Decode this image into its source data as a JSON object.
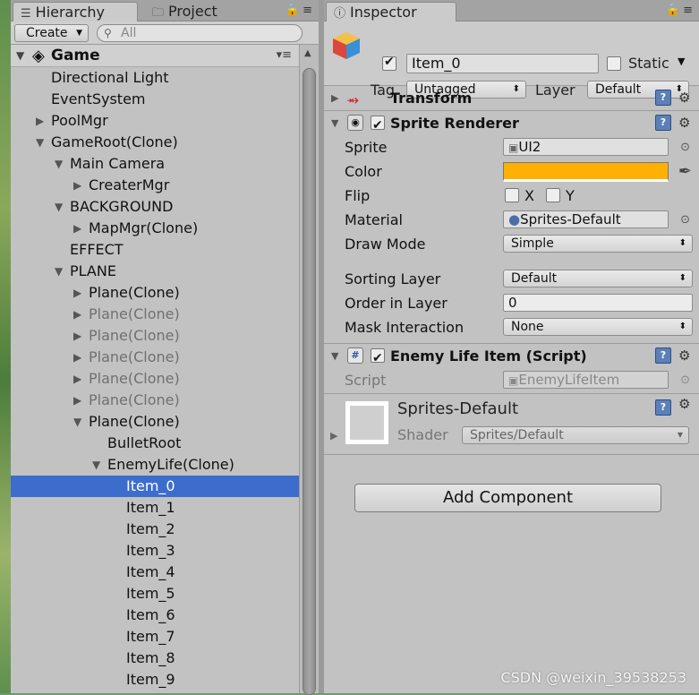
{
  "hierarchy": {
    "tab_label": "Hierarchy",
    "project_tab_label": "Project",
    "create_label": "Create",
    "search_placeholder": "All",
    "scene_name": "Game",
    "items": [
      {
        "label": "Directional Light",
        "depth": 0,
        "arrow": "none",
        "dim": false,
        "selected": false
      },
      {
        "label": "EventSystem",
        "depth": 0,
        "arrow": "none",
        "dim": false,
        "selected": false
      },
      {
        "label": "PoolMgr",
        "depth": 0,
        "arrow": "collapsed",
        "dim": false,
        "selected": false
      },
      {
        "label": "GameRoot(Clone)",
        "depth": 0,
        "arrow": "expanded",
        "dim": false,
        "selected": false
      },
      {
        "label": "Main Camera",
        "depth": 1,
        "arrow": "expanded",
        "dim": false,
        "selected": false
      },
      {
        "label": "CreaterMgr",
        "depth": 2,
        "arrow": "collapsed",
        "dim": false,
        "selected": false
      },
      {
        "label": "BACKGROUND",
        "depth": 1,
        "arrow": "expanded",
        "dim": false,
        "selected": false
      },
      {
        "label": "MapMgr(Clone)",
        "depth": 2,
        "arrow": "collapsed",
        "dim": false,
        "selected": false
      },
      {
        "label": "EFFECT",
        "depth": 1,
        "arrow": "none",
        "dim": false,
        "selected": false
      },
      {
        "label": "PLANE",
        "depth": 1,
        "arrow": "expanded",
        "dim": false,
        "selected": false
      },
      {
        "label": "Plane(Clone)",
        "depth": 2,
        "arrow": "collapsed",
        "dim": false,
        "selected": false
      },
      {
        "label": "Plane(Clone)",
        "depth": 2,
        "arrow": "collapsed",
        "dim": true,
        "selected": false
      },
      {
        "label": "Plane(Clone)",
        "depth": 2,
        "arrow": "collapsed",
        "dim": true,
        "selected": false
      },
      {
        "label": "Plane(Clone)",
        "depth": 2,
        "arrow": "collapsed",
        "dim": true,
        "selected": false
      },
      {
        "label": "Plane(Clone)",
        "depth": 2,
        "arrow": "collapsed",
        "dim": true,
        "selected": false
      },
      {
        "label": "Plane(Clone)",
        "depth": 2,
        "arrow": "collapsed",
        "dim": true,
        "selected": false
      },
      {
        "label": "Plane(Clone)",
        "depth": 2,
        "arrow": "expanded",
        "dim": false,
        "selected": false
      },
      {
        "label": "BulletRoot",
        "depth": 3,
        "arrow": "none",
        "dim": false,
        "selected": false
      },
      {
        "label": "EnemyLife(Clone)",
        "depth": 3,
        "arrow": "expanded",
        "dim": false,
        "selected": false
      },
      {
        "label": "Item_0",
        "depth": 4,
        "arrow": "none",
        "dim": false,
        "selected": true
      },
      {
        "label": "Item_1",
        "depth": 4,
        "arrow": "none",
        "dim": false,
        "selected": false
      },
      {
        "label": "Item_2",
        "depth": 4,
        "arrow": "none",
        "dim": false,
        "selected": false
      },
      {
        "label": "Item_3",
        "depth": 4,
        "arrow": "none",
        "dim": false,
        "selected": false
      },
      {
        "label": "Item_4",
        "depth": 4,
        "arrow": "none",
        "dim": false,
        "selected": false
      },
      {
        "label": "Item_5",
        "depth": 4,
        "arrow": "none",
        "dim": false,
        "selected": false
      },
      {
        "label": "Item_6",
        "depth": 4,
        "arrow": "none",
        "dim": false,
        "selected": false
      },
      {
        "label": "Item_7",
        "depth": 4,
        "arrow": "none",
        "dim": false,
        "selected": false
      },
      {
        "label": "Item_8",
        "depth": 4,
        "arrow": "none",
        "dim": false,
        "selected": false
      },
      {
        "label": "Item_9",
        "depth": 4,
        "arrow": "none",
        "dim": false,
        "selected": false
      }
    ]
  },
  "inspector": {
    "tab_label": "Inspector",
    "object_name": "Item_0",
    "active": true,
    "static_label": "Static",
    "tag_label": "Tag",
    "tag_value": "Untagged",
    "layer_label": "Layer",
    "layer_value": "Default",
    "transform": {
      "title": "Transform"
    },
    "sprite_renderer": {
      "title": "Sprite Renderer",
      "enabled": true,
      "sprite_label": "Sprite",
      "sprite_value": "UI2",
      "color_label": "Color",
      "color_value": "#ffb000",
      "flip_label": "Flip",
      "flip_x_label": "X",
      "flip_y_label": "Y",
      "material_label": "Material",
      "material_value": "Sprites-Default",
      "draw_mode_label": "Draw Mode",
      "draw_mode_value": "Simple",
      "sorting_layer_label": "Sorting Layer",
      "sorting_layer_value": "Default",
      "order_label": "Order in Layer",
      "order_value": "0",
      "mask_label": "Mask Interaction",
      "mask_value": "None"
    },
    "script_comp": {
      "title": "Enemy Life Item (Script)",
      "enabled": true,
      "script_label": "Script",
      "script_value": "EnemyLifeItem"
    },
    "material": {
      "name": "Sprites-Default",
      "shader_label": "Shader",
      "shader_value": "Sprites/Default"
    },
    "add_component_label": "Add Component"
  },
  "watermark": "CSDN @weixin_39538253"
}
